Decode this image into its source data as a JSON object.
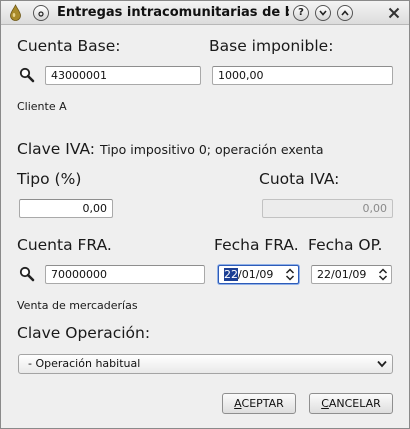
{
  "window": {
    "title": "Entregas intracomunitarias de b",
    "help_label": "?"
  },
  "cuenta_base": {
    "label": "Cuenta Base:",
    "value": "43000001",
    "name": "Cliente A"
  },
  "base_imponible": {
    "label": "Base imponible:",
    "value": "1000,00"
  },
  "clave_iva": {
    "label": "Clave IVA:",
    "description": "Tipo impositivo 0; operación exenta"
  },
  "tipo": {
    "label": "Tipo (%)",
    "value": "0,00"
  },
  "cuota_iva": {
    "label": "Cuota IVA:",
    "value": "0,00"
  },
  "cuenta_fra": {
    "label": "Cuenta FRA.",
    "value": "70000000",
    "name": "Venta de mercaderías"
  },
  "fecha_fra": {
    "label": "Fecha FRA.",
    "value_selected": "22",
    "value_rest": "/01/09"
  },
  "fecha_op": {
    "label": "Fecha OP.",
    "value": "22/01/09"
  },
  "clave_operacion": {
    "label": "Clave Operación:",
    "selected": "- Operación habitual"
  },
  "buttons": {
    "accept_label": "ACEPTAR",
    "accept_mnemonic": "A",
    "cancel_label": "CANCELAR",
    "cancel_mnemonic": "C"
  }
}
